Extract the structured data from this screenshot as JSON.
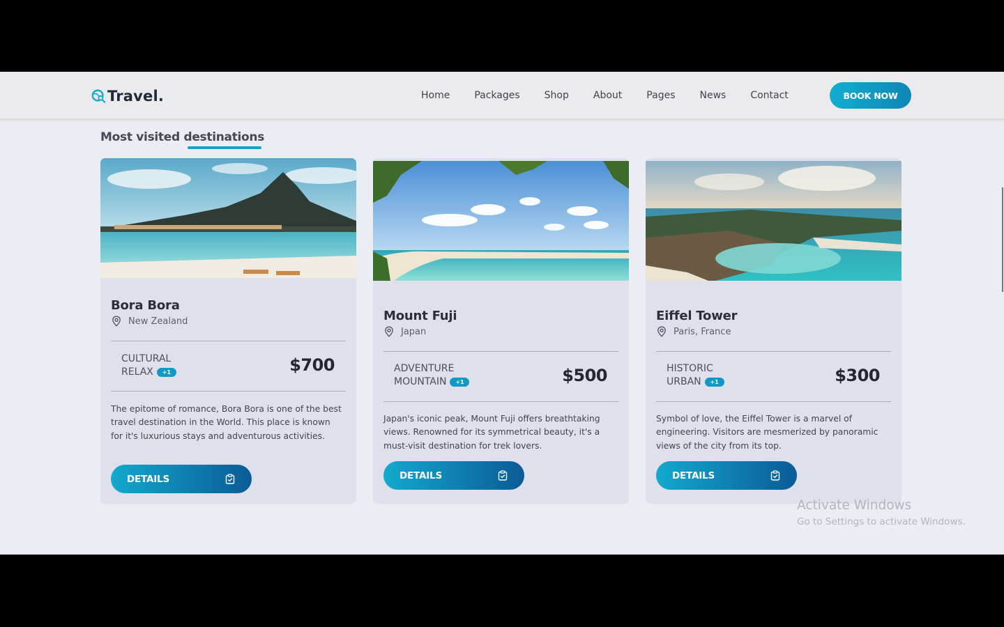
{
  "brand": {
    "name": "Travel.",
    "logo_icon": "globe-search-icon",
    "accent": "#13a5c8"
  },
  "nav": {
    "links": [
      "Home",
      "Packages",
      "Shop",
      "About",
      "Pages",
      "News",
      "Contact"
    ],
    "cta": "BOOK NOW"
  },
  "section": {
    "title": "Most visited destinations"
  },
  "cards": [
    {
      "name": "Bora Bora",
      "location": "New Zealand",
      "tags": [
        "CULTURAL",
        "RELAX"
      ],
      "extra": "+1",
      "price": "$700",
      "description": "The epitome of romance, Bora Bora is one of the best travel destination in the World. This place is known for it's luxurious stays and adventurous activities.",
      "button": "DETAILS",
      "image": "tropical-island-beach"
    },
    {
      "name": "Mount Fuji",
      "location": "Japan",
      "tags": [
        "ADVENTURE",
        "MOUNTAIN"
      ],
      "extra": "+1",
      "price": "$500",
      "description": "Japan's iconic peak, Mount Fuji offers breathtaking views. Renowned for its symmetrical beauty, it's a must-visit destination for trek lovers.",
      "button": "DETAILS",
      "image": "palm-beach"
    },
    {
      "name": "Eiffel Tower",
      "location": "Paris, France",
      "tags": [
        "HISTORIC",
        "URBAN"
      ],
      "extra": "+1",
      "price": "$300",
      "description": "Symbol of love, the Eiffel Tower is a marvel of engineering. Visitors are mesmerized by panoramic views of the city from its top.",
      "button": "DETAILS",
      "image": "aerial-resort-island"
    }
  ],
  "watermark": {
    "title": "Activate Windows",
    "subtitle": "Go to Settings to activate Windows."
  }
}
